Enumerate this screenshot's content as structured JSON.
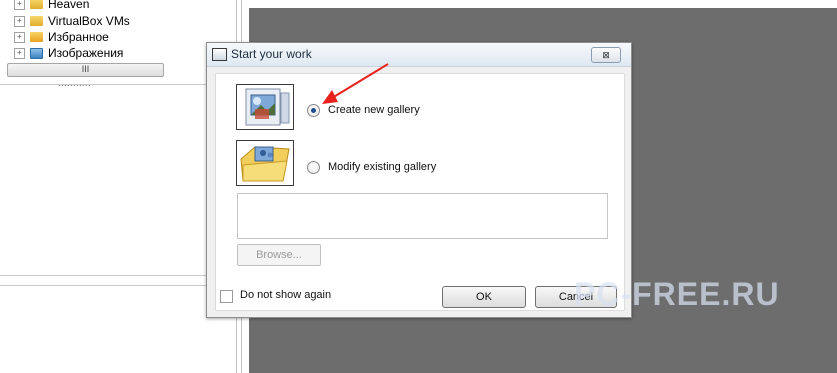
{
  "explorer": {
    "items": [
      {
        "label": "Избранное",
        "icon": "star-folder-icon"
      },
      {
        "label": "Изображения",
        "icon": "pictures-folder-icon"
      }
    ],
    "top_items": [
      {
        "label": "VirtualBox VMs",
        "icon": "folder-icon"
      }
    ],
    "scrollbar_grip": "III",
    "splitter_grip": "...........",
    "cut_label": "Heaven"
  },
  "dialog": {
    "title": "Start your work",
    "close_label": "⊠",
    "options": [
      {
        "label": "Create new gallery",
        "selected": true,
        "icon": "new-gallery-icon"
      },
      {
        "label": "Modify existing gallery",
        "selected": false,
        "icon": "existing-gallery-icon"
      }
    ],
    "path_value": "",
    "browse_label": "Browse...",
    "checkbox_label": "Do not show again",
    "checkbox_checked": false,
    "ok_label": "OK",
    "cancel_label": "Cancel"
  },
  "watermark": "PC-FREE.RU",
  "colors": {
    "workspace": "#6d6d6d",
    "arrow": "#e8211c",
    "radio_selected": "#1e4c8f"
  }
}
